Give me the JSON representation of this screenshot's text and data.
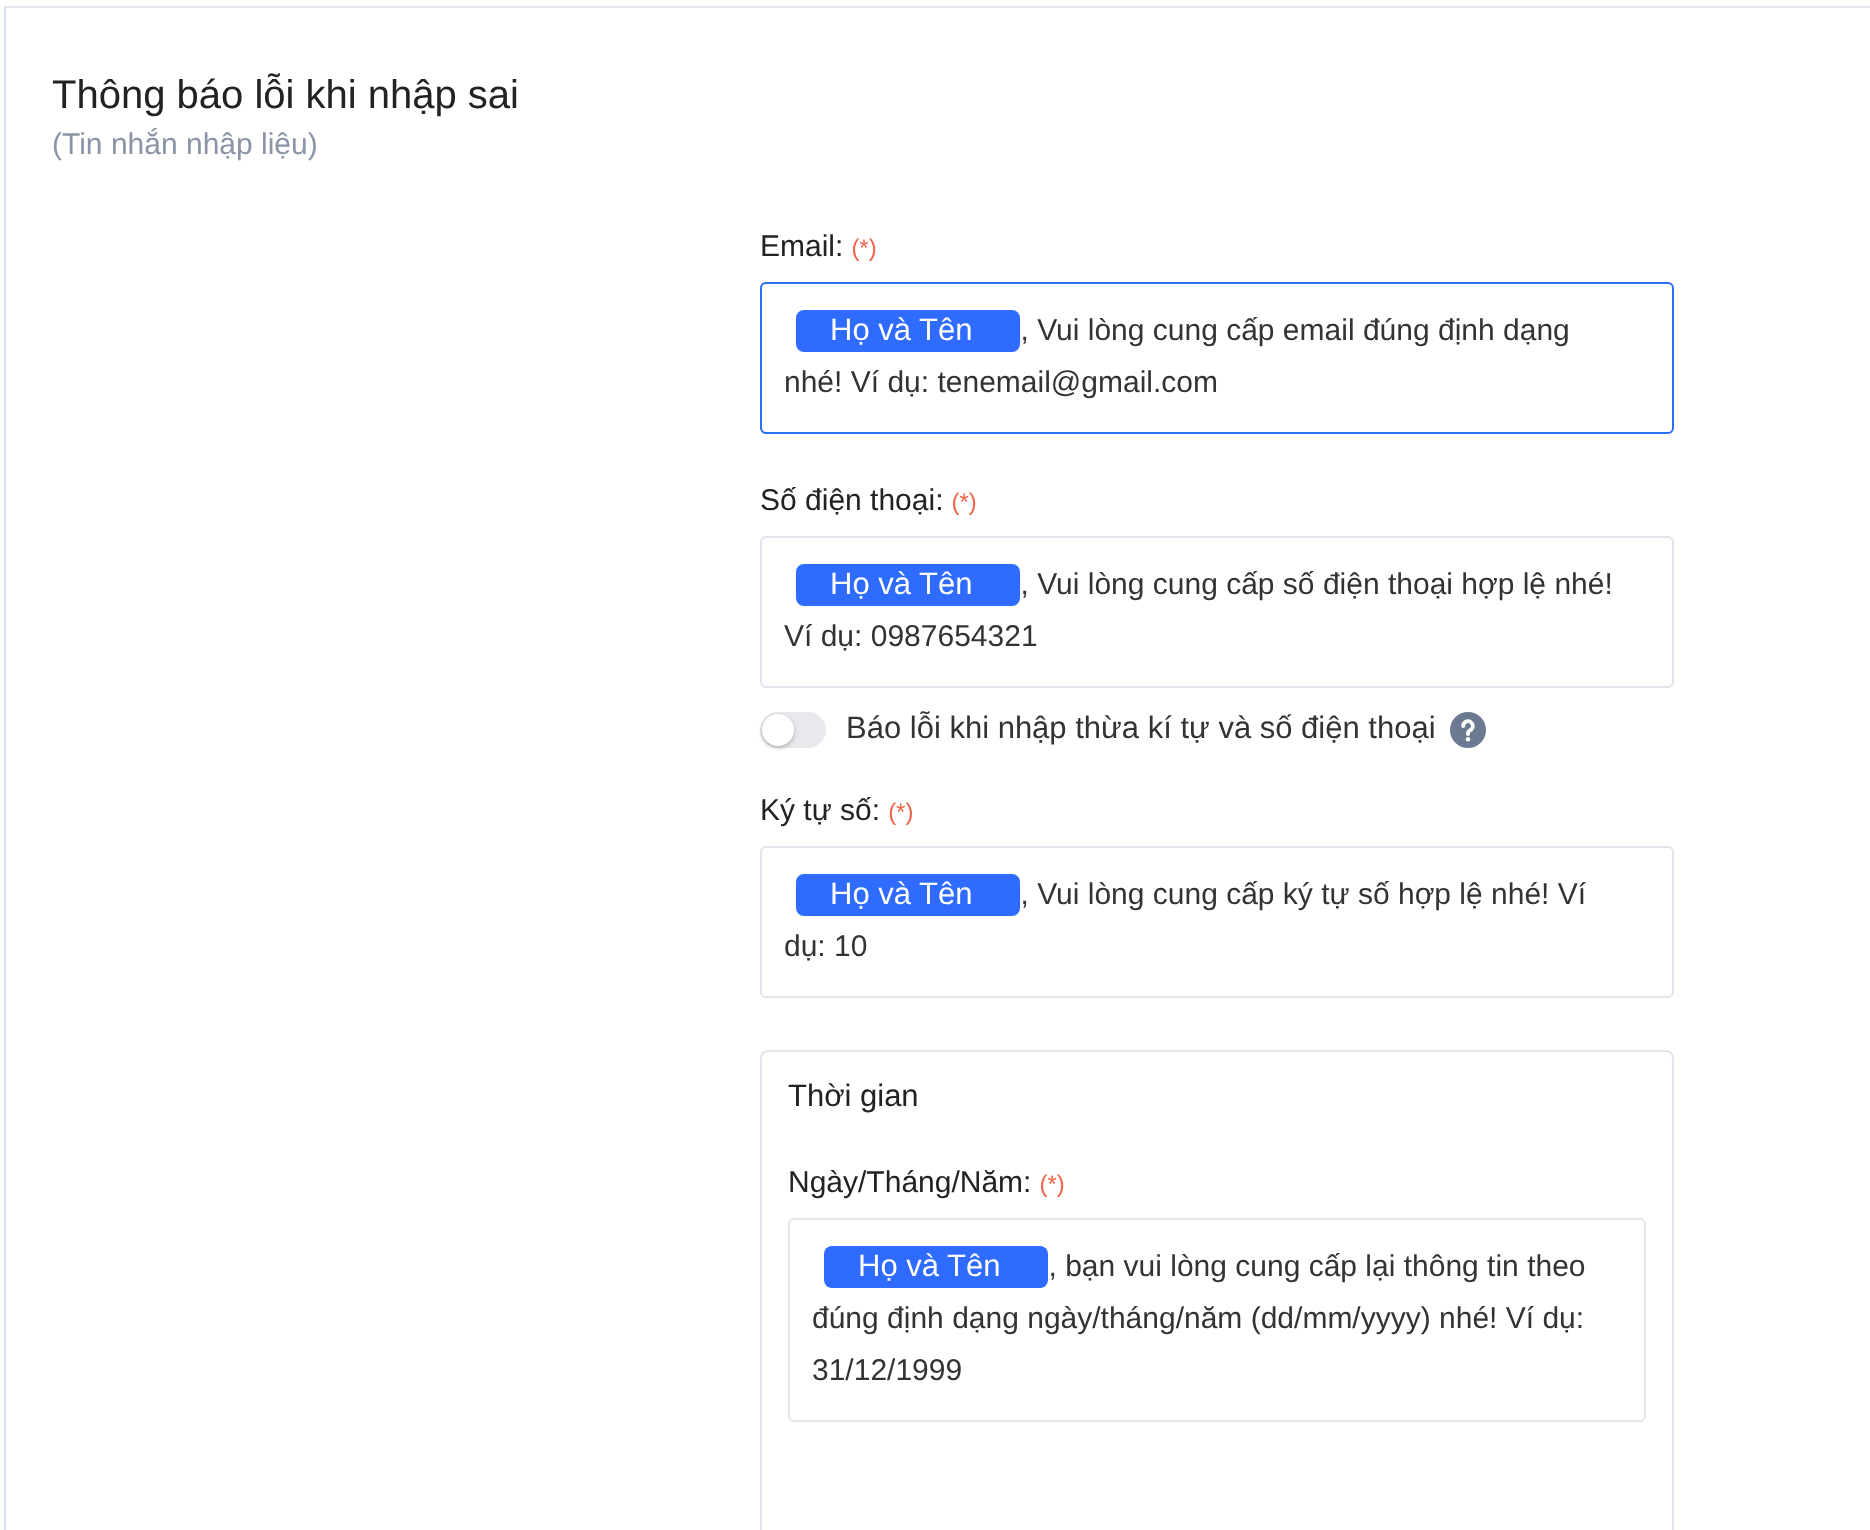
{
  "header": {
    "title": "Thông báo lỗi khi nhập sai",
    "subtitle": "(Tin nhắn nhập liệu)"
  },
  "items": [
    {
      "kind": "field",
      "label": "Email:",
      "required": "(*)",
      "focused": true,
      "tag": "Họ và Tên",
      "message": ", Vui lòng cung cấp email đúng định dạng nhé! Ví dụ: tenemail@gmail.com"
    },
    {
      "kind": "field",
      "label": "Số điện thoại:",
      "required": "(*)",
      "focused": false,
      "tag": "Họ và Tên",
      "message": ", Vui lòng cung cấp số điện thoại hợp lệ nhé! Ví dụ: 0987654321"
    },
    {
      "kind": "toggle",
      "on": false,
      "label": "Báo lỗi khi nhập thừa kí tự và số điện thoại"
    },
    {
      "kind": "field",
      "label": "Ký tự số:",
      "required": "(*)",
      "focused": false,
      "tag": "Họ và Tên",
      "message": ", Vui lòng cung cấp ký tự số hợp lệ nhé! Ví dụ: 10"
    },
    {
      "kind": "group",
      "title": "Thời gian",
      "fields": [
        {
          "kind": "field",
          "label": "Ngày/Tháng/Năm:",
          "required": "(*)",
          "focused": false,
          "tag": "Họ và Tên",
          "message": ", bạn vui lòng cung cấp lại thông tin theo đúng định dạng ngày/tháng/năm (dd/mm/yyyy) nhé! Ví dụ: 31/12/1999"
        }
      ]
    }
  ]
}
